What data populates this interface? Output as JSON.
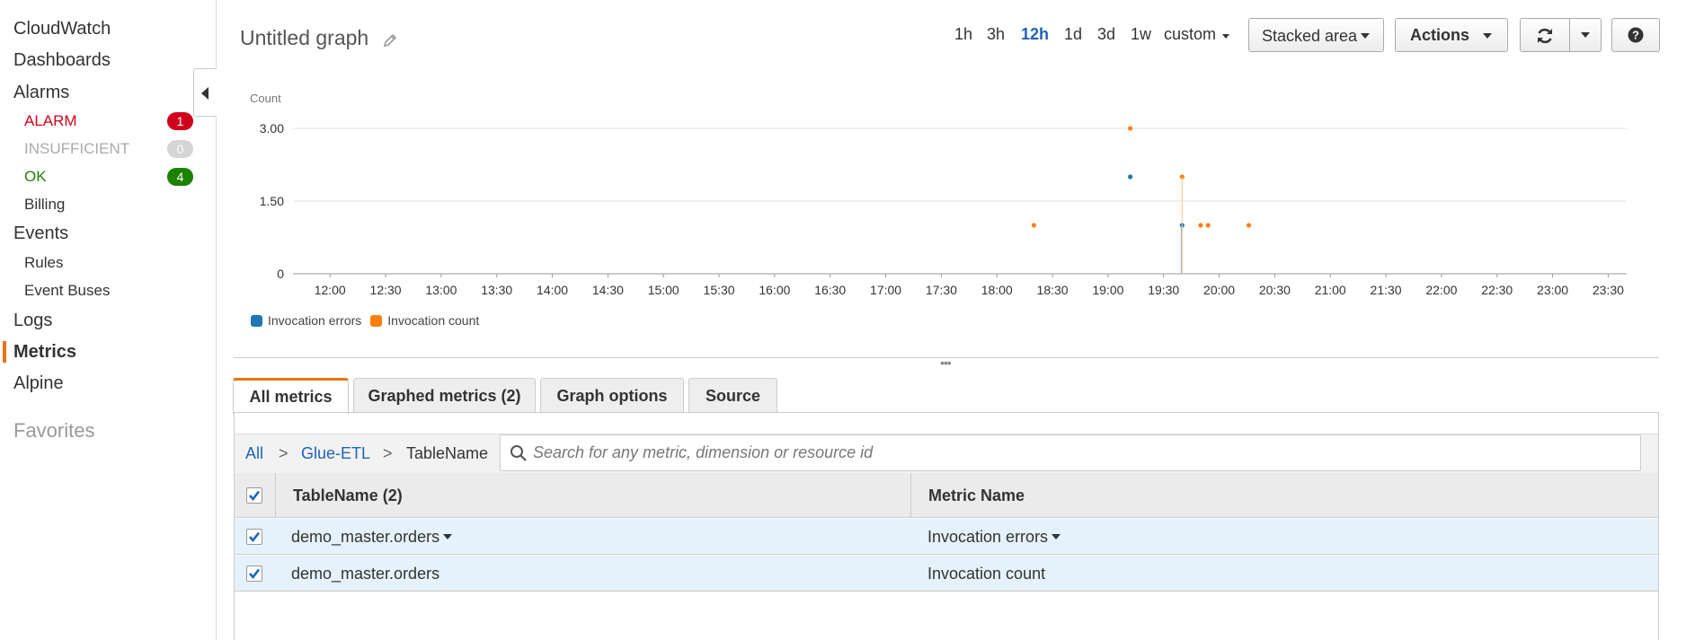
{
  "sidebar": {
    "items": [
      {
        "label": "CloudWatch"
      },
      {
        "label": "Dashboards"
      },
      {
        "label": "Alarms"
      },
      {
        "label": "ALARM",
        "badge": "1",
        "color": "#d0021b",
        "badge_color": "#d0021b"
      },
      {
        "label": "INSUFFICIENT",
        "badge": "0",
        "color": "#aaaaaa",
        "badge_color": "#d5d5d5"
      },
      {
        "label": "OK",
        "badge": "4",
        "color": "#1d8102",
        "badge_color": "#1d8102"
      },
      {
        "label": "Billing"
      },
      {
        "label": "Events"
      },
      {
        "label": "Rules"
      },
      {
        "label": "Event Buses"
      },
      {
        "label": "Logs"
      },
      {
        "label": "Metrics",
        "active": true
      },
      {
        "label": "Alpine"
      },
      {
        "label": "Favorites"
      }
    ]
  },
  "header": {
    "title": "Untitled graph",
    "time_ranges": [
      "1h",
      "3h",
      "12h",
      "1d",
      "3d",
      "1w",
      "custom"
    ],
    "active_range": "12h",
    "graph_type": "Stacked area",
    "actions_label": "Actions"
  },
  "chart_data": {
    "type": "scatter",
    "ylabel": "Count",
    "y_ticks": [
      "0",
      "1.50",
      "3.00"
    ],
    "ylim": [
      0,
      3
    ],
    "x_ticks": [
      "12:00",
      "12:30",
      "13:00",
      "13:30",
      "14:00",
      "14:30",
      "15:00",
      "15:30",
      "16:00",
      "16:30",
      "17:00",
      "17:30",
      "18:00",
      "18:30",
      "19:00",
      "19:30",
      "20:00",
      "20:30",
      "21:00",
      "21:30",
      "22:00",
      "22:30",
      "23:00",
      "23:30"
    ],
    "series": [
      {
        "name": "Invocation errors",
        "color": "#1f77b4",
        "points": [
          [
            "19:12",
            2
          ],
          [
            "19:40",
            1
          ]
        ]
      },
      {
        "name": "Invocation count",
        "color": "#ff7f0e",
        "points": [
          [
            "18:20",
            1
          ],
          [
            "19:12",
            3
          ],
          [
            "19:40",
            2
          ],
          [
            "19:50",
            1
          ],
          [
            "19:54",
            1
          ],
          [
            "20:16",
            1
          ]
        ]
      }
    ]
  },
  "tabs": [
    "All metrics",
    "Graphed metrics (2)",
    "Graph options",
    "Source"
  ],
  "breadcrumb": {
    "all": "All",
    "namespace": "Glue-ETL",
    "dimension": "TableName",
    "sep": ">"
  },
  "search": {
    "placeholder": "Search for any metric, dimension or resource id"
  },
  "table": {
    "headers": [
      "TableName  (2)",
      "Metric Name"
    ],
    "rows": [
      {
        "table_name": "demo_master.orders",
        "metric": "Invocation errors",
        "checked": true
      },
      {
        "table_name": "demo_master.orders",
        "metric": "Invocation count",
        "checked": true
      }
    ]
  }
}
